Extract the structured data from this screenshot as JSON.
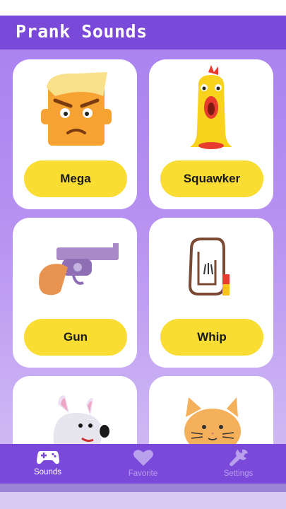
{
  "header": {
    "title": "Prank Sounds"
  },
  "sounds": [
    {
      "label": "Mega",
      "icon": "angry-face-icon"
    },
    {
      "label": "Squawker",
      "icon": "rubber-chicken-icon"
    },
    {
      "label": "Gun",
      "icon": "revolver-icon"
    },
    {
      "label": "Whip",
      "icon": "whip-icon"
    },
    {
      "label": "",
      "icon": "dog-icon"
    },
    {
      "label": "",
      "icon": "cat-icon"
    }
  ],
  "tabs": [
    {
      "label": "Sounds",
      "icon": "gamepad-icon",
      "active": true
    },
    {
      "label": "Favorite",
      "icon": "heart-icon",
      "active": false
    },
    {
      "label": "Settings",
      "icon": "wrench-icon",
      "active": false
    }
  ],
  "colors": {
    "accent": "#7a49d9",
    "button": "#f9dd33"
  }
}
